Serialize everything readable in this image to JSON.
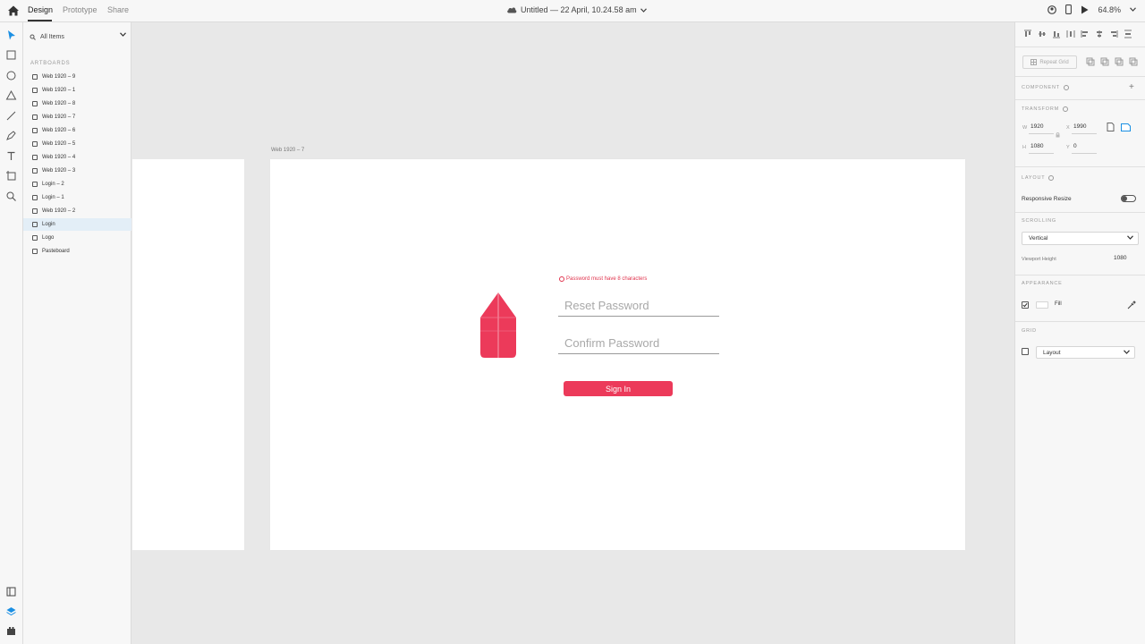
{
  "top_bar": {
    "tabs": [
      "Design",
      "Prototype",
      "Share"
    ],
    "document_title": "Untitled — 22 April, 10.24.58 am",
    "zoom": "64.8%"
  },
  "layers": {
    "search_label": "All Items",
    "heading": "ARTBOARDS",
    "items": [
      "Web 1920 – 9",
      "Web 1920 – 1",
      "Web 1920 – 8",
      "Web 1920 – 7",
      "Web 1920 – 6",
      "Web 1920 – 5",
      "Web 1920 – 4",
      "Web 1920 – 3",
      "Login – 2",
      "Login – 1",
      "Web 1920 – 2",
      "Login",
      "Logo",
      "Pasteboard"
    ],
    "selected_index": 11
  },
  "canvas": {
    "artboard_label": "Web 1920 – 7",
    "error_text": "Password must have 8 characters",
    "reset_placeholder": "Reset Password",
    "confirm_placeholder": "Confirm Password",
    "signin_label": "Sign In",
    "accent_color": "#ec3a5a"
  },
  "properties": {
    "repeat_grid": "Repeat Grid",
    "component_title": "COMPONENT",
    "transform_title": "TRANSFORM",
    "w_label": "W",
    "w_value": "1920",
    "x_label": "X",
    "x_value": "1990",
    "h_label": "H",
    "h_value": "1080",
    "y_label": "Y",
    "y_value": "0",
    "layout_title": "LAYOUT",
    "responsive_resize": "Responsive Resize",
    "scrolling_title": "SCROLLING",
    "scrolling_value": "Vertical",
    "viewport_height_label": "Viewport Height",
    "viewport_height_value": "1080",
    "appearance_title": "APPEARANCE",
    "fill_label": "Fill",
    "grid_title": "GRID",
    "grid_value": "Layout"
  }
}
